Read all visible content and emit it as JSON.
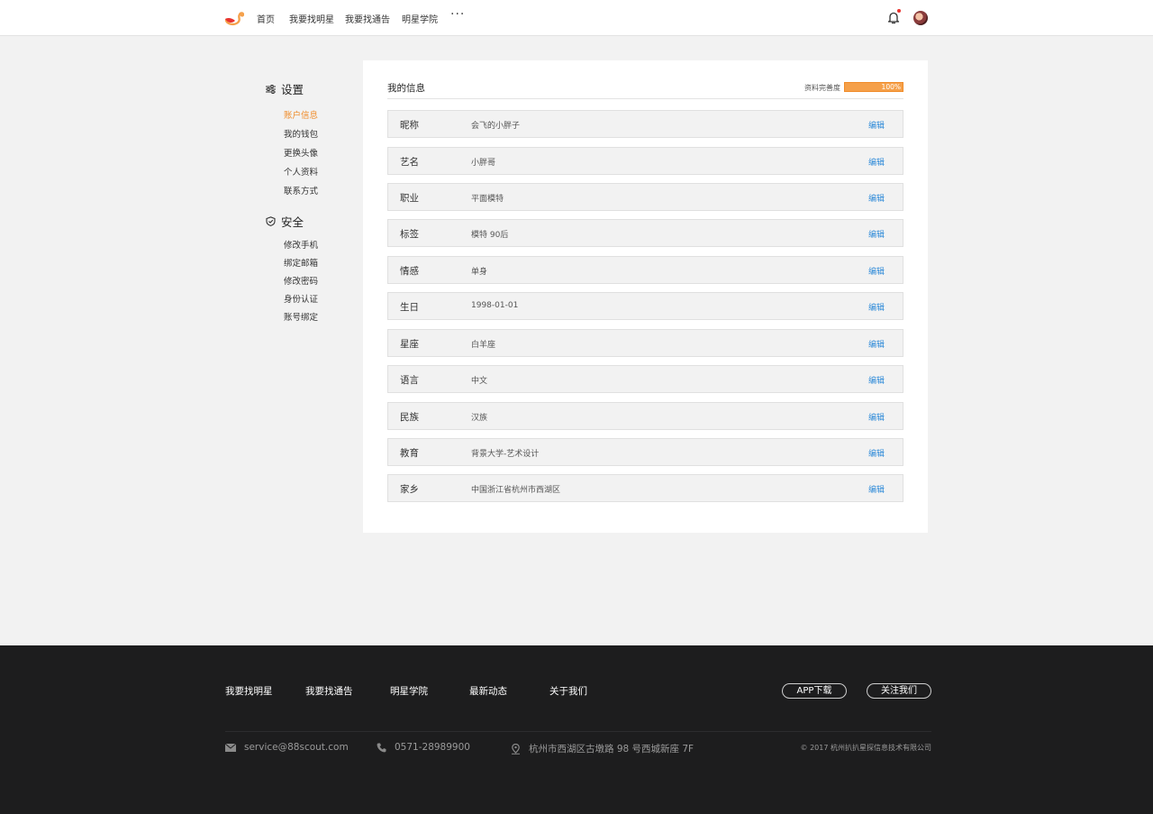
{
  "header": {
    "nav": [
      "首页",
      "我要找明星",
      "我要找通告",
      "明星学院"
    ],
    "more": "···"
  },
  "sidebar": {
    "settings_title": "设置",
    "settings_items": [
      "账户信息",
      "我的钱包",
      "更换头像",
      "个人资料",
      "联系方式"
    ],
    "security_title": "安全",
    "security_items": [
      "修改手机",
      "绑定邮箱",
      "修改密码",
      "身份认证",
      "账号绑定"
    ]
  },
  "main": {
    "title": "我的信息",
    "completion_label": "资料完善度",
    "completion_text": "100%",
    "completion_value": 1.0,
    "edit_label": "编辑",
    "rows": [
      {
        "label": "昵称",
        "value": "会飞的小胖子"
      },
      {
        "label": "艺名",
        "value": "小胖哥"
      },
      {
        "label": "职业",
        "value": "平面模特"
      },
      {
        "label": "标签",
        "value": "模特  90后"
      },
      {
        "label": "情感",
        "value": "单身"
      },
      {
        "label": "生日",
        "value": "1998-01-01"
      },
      {
        "label": "星座",
        "value": "白羊座"
      },
      {
        "label": "语言",
        "value": "中文"
      },
      {
        "label": "民族",
        "value": "汉族"
      },
      {
        "label": "教育",
        "value": "背景大学-艺术设计"
      },
      {
        "label": "家乡",
        "value": "中国浙江省杭州市西湖区"
      }
    ]
  },
  "footer": {
    "links": [
      "我要找明星",
      "我要找通告",
      "明星学院",
      "最新动态",
      "关于我们"
    ],
    "app_button": "APP下载",
    "follow_button": "关注我们",
    "email": "service@88scout.com",
    "phone": "0571-28989900",
    "address": "杭州市西湖区古墩路 98 号西城新座 7F",
    "copyright": "© 2017 杭州扒扒星探信息技术有限公司"
  },
  "colors": {
    "accent": "#f08c2a",
    "link": "#2e8ad8",
    "footer_bg": "#1d1d1e"
  }
}
